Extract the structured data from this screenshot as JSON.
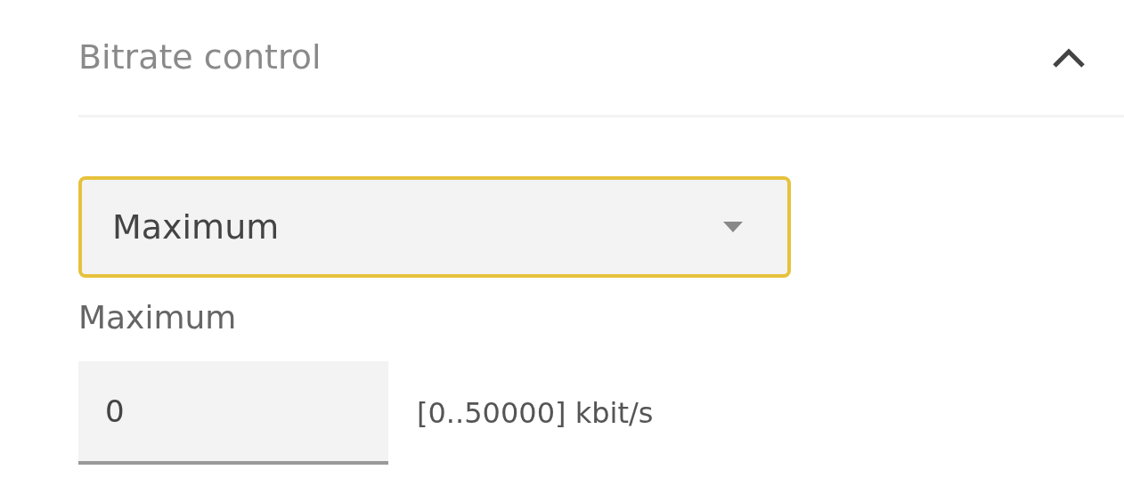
{
  "section": {
    "title": "Bitrate control",
    "expanded": true
  },
  "mode_select": {
    "value": "Maximum",
    "focused": true
  },
  "maximum_field": {
    "label": "Maximum",
    "value": "0",
    "hint": "[0..50000] kbit/s"
  }
}
